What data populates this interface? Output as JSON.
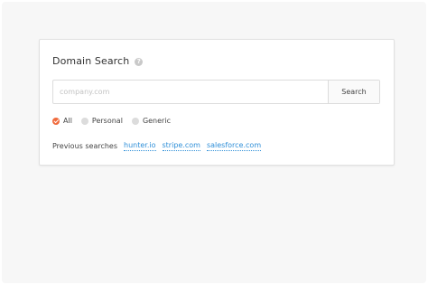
{
  "domain_search": {
    "title": "Domain Search",
    "help_icon_symbol": "?",
    "search": {
      "placeholder": "company.com",
      "value": "",
      "button_label": "Search"
    },
    "filters": [
      {
        "label": "All",
        "checked": true
      },
      {
        "label": "Personal",
        "checked": false
      },
      {
        "label": "Generic",
        "checked": false
      }
    ],
    "previous_searches": {
      "label": "Previous searches",
      "items": [
        "hunter.io",
        "stripe.com",
        "salesforce.com"
      ]
    }
  },
  "colors": {
    "accent_checked": "#f06b3d",
    "link": "#2f8fd8",
    "background": "#f7f7f7"
  }
}
